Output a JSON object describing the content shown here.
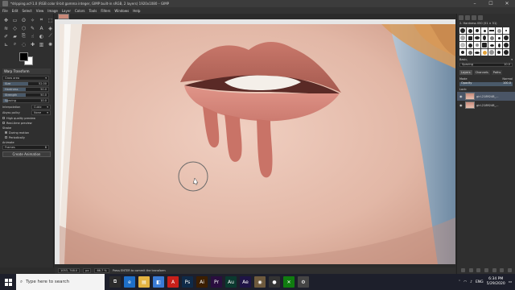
{
  "window": {
    "title": "*dripping.xcf-1.0 (RGB color 8-bit gamma integer, GIMP built-in sRGB, 2 layers) 1920x1080 – GIMP",
    "controls": [
      "–",
      "☐",
      "✕"
    ]
  },
  "menu": [
    "File",
    "Edit",
    "Select",
    "View",
    "Image",
    "Layer",
    "Colors",
    "Tools",
    "Filters",
    "Windows",
    "Help"
  ],
  "tool_options": {
    "title": "Warp Transform",
    "behavior": "Grow area",
    "size_label": "Size",
    "size_value": "52.00",
    "size_fill": 0.55,
    "hardness_label": "Hardness",
    "hardness_value": "50.0",
    "hardness_fill": 0.5,
    "strength_label": "Strength",
    "strength_value": "50.0",
    "strength_fill": 0.5,
    "spacing_label": "Spacing",
    "spacing_value": "10.0",
    "spacing_fill": 0.1,
    "interpolation_label": "Interpolation",
    "interpolation_value": "Cubic",
    "abyss_label": "Abyss policy",
    "abyss_value": "None",
    "high_quality_preview": "High quality preview",
    "real_time_preview": "Real-time preview",
    "strokes_label": "Stroke",
    "during_motion": "During motion",
    "periodically": "Periodically",
    "animate_label": "Animate",
    "frames_label": "Frames",
    "frames_value": "8",
    "create_animation": "Create Animation"
  },
  "statusbar": {
    "coords": "1053, 748.0",
    "unit": "px",
    "zoom": "66.7 %",
    "message": "Press ENTER to commit the transform"
  },
  "brushes": {
    "title": "2. Hardness 050 (51 × 51)",
    "filter_label": "Basic,",
    "spacing_label": "Spacing",
    "spacing_value": "10.0"
  },
  "layers_panel": {
    "tabs": [
      "Layers",
      "Channels",
      "Paths"
    ],
    "mode_label": "Mode",
    "mode_value": "Normal",
    "opacity_label": "Opacity",
    "opacity_value": "100.0",
    "lock_label": "Lock:",
    "layers": [
      {
        "name": "girl-2189248_..."
      },
      {
        "name": "girl-2189248_..."
      }
    ]
  },
  "taskbar": {
    "search_placeholder": "Type here to search",
    "apps": [
      {
        "icon": "task-view-icon",
        "glyph": "⧉",
        "color": "#2b2b2b"
      },
      {
        "icon": "edge-icon",
        "glyph": "e",
        "color": "#1e6fc8"
      },
      {
        "icon": "explorer-icon",
        "glyph": "▤",
        "color": "#e3b341"
      },
      {
        "icon": "store-icon",
        "glyph": "◧",
        "color": "#3a7bd5"
      },
      {
        "icon": "acrobat-icon",
        "glyph": "A",
        "color": "#c8201a"
      },
      {
        "icon": "photoshop-icon",
        "glyph": "Ps",
        "color": "#0f2a48"
      },
      {
        "icon": "illustrator-icon",
        "glyph": "Ai",
        "color": "#3b1e00"
      },
      {
        "icon": "premiere-icon",
        "glyph": "Pr",
        "color": "#2a0e3f"
      },
      {
        "icon": "audition-icon",
        "glyph": "Au",
        "color": "#0b3a2f"
      },
      {
        "icon": "aftereffects-icon",
        "glyph": "Ae",
        "color": "#1f1446"
      },
      {
        "icon": "gimp-icon",
        "glyph": "◉",
        "color": "#6e5a3d"
      },
      {
        "icon": "obs-icon",
        "glyph": "●",
        "color": "#333333"
      },
      {
        "icon": "xbox-icon",
        "glyph": "✕",
        "color": "#107c10"
      },
      {
        "icon": "settings-icon",
        "glyph": "⚙",
        "color": "#444444"
      }
    ],
    "language": "ENG",
    "time": "6:34 PM",
    "date": "5/29/2020"
  }
}
